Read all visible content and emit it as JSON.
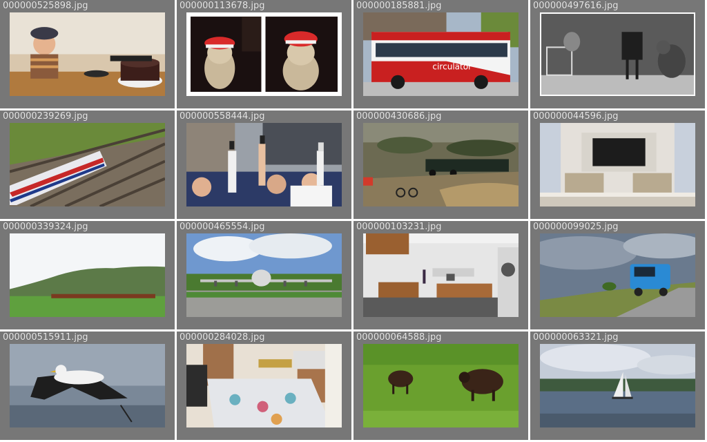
{
  "tiles": [
    {
      "filename": "000000525898.jpg",
      "scene": "boy-with-birthday-cake"
    },
    {
      "filename": "000000113678.jpg",
      "scene": "dogs-in-santa-hats"
    },
    {
      "filename": "000000185881.jpg",
      "scene": "red-white-city-bus"
    },
    {
      "filename": "000000497616.jpg",
      "scene": "cats-with-old-camera"
    },
    {
      "filename": "000000239269.jpg",
      "scene": "underground-train-on-tracks"
    },
    {
      "filename": "000000558444.jpg",
      "scene": "crowd-holding-phones"
    },
    {
      "filename": "000000430686.jpg",
      "scene": "model-railway-diorama"
    },
    {
      "filename": "000000044596.jpg",
      "scene": "hotel-room-with-tv"
    },
    {
      "filename": "000000339324.jpg",
      "scene": "hill-landscape-with-train"
    },
    {
      "filename": "000000465554.jpg",
      "scene": "propeller-airplane-on-display"
    },
    {
      "filename": "000000103231.jpg",
      "scene": "modern-kitchen-interior"
    },
    {
      "filename": "000000099025.jpg",
      "scene": "blue-truck-on-road"
    },
    {
      "filename": "000000515911.jpg",
      "scene": "seagull-in-flight"
    },
    {
      "filename": "000000284028.jpg",
      "scene": "bedroom-with-quilt"
    },
    {
      "filename": "000000064588.jpg",
      "scene": "sheep-on-grass"
    },
    {
      "filename": "000000063321.jpg",
      "scene": "sailboat-on-lake"
    }
  ]
}
